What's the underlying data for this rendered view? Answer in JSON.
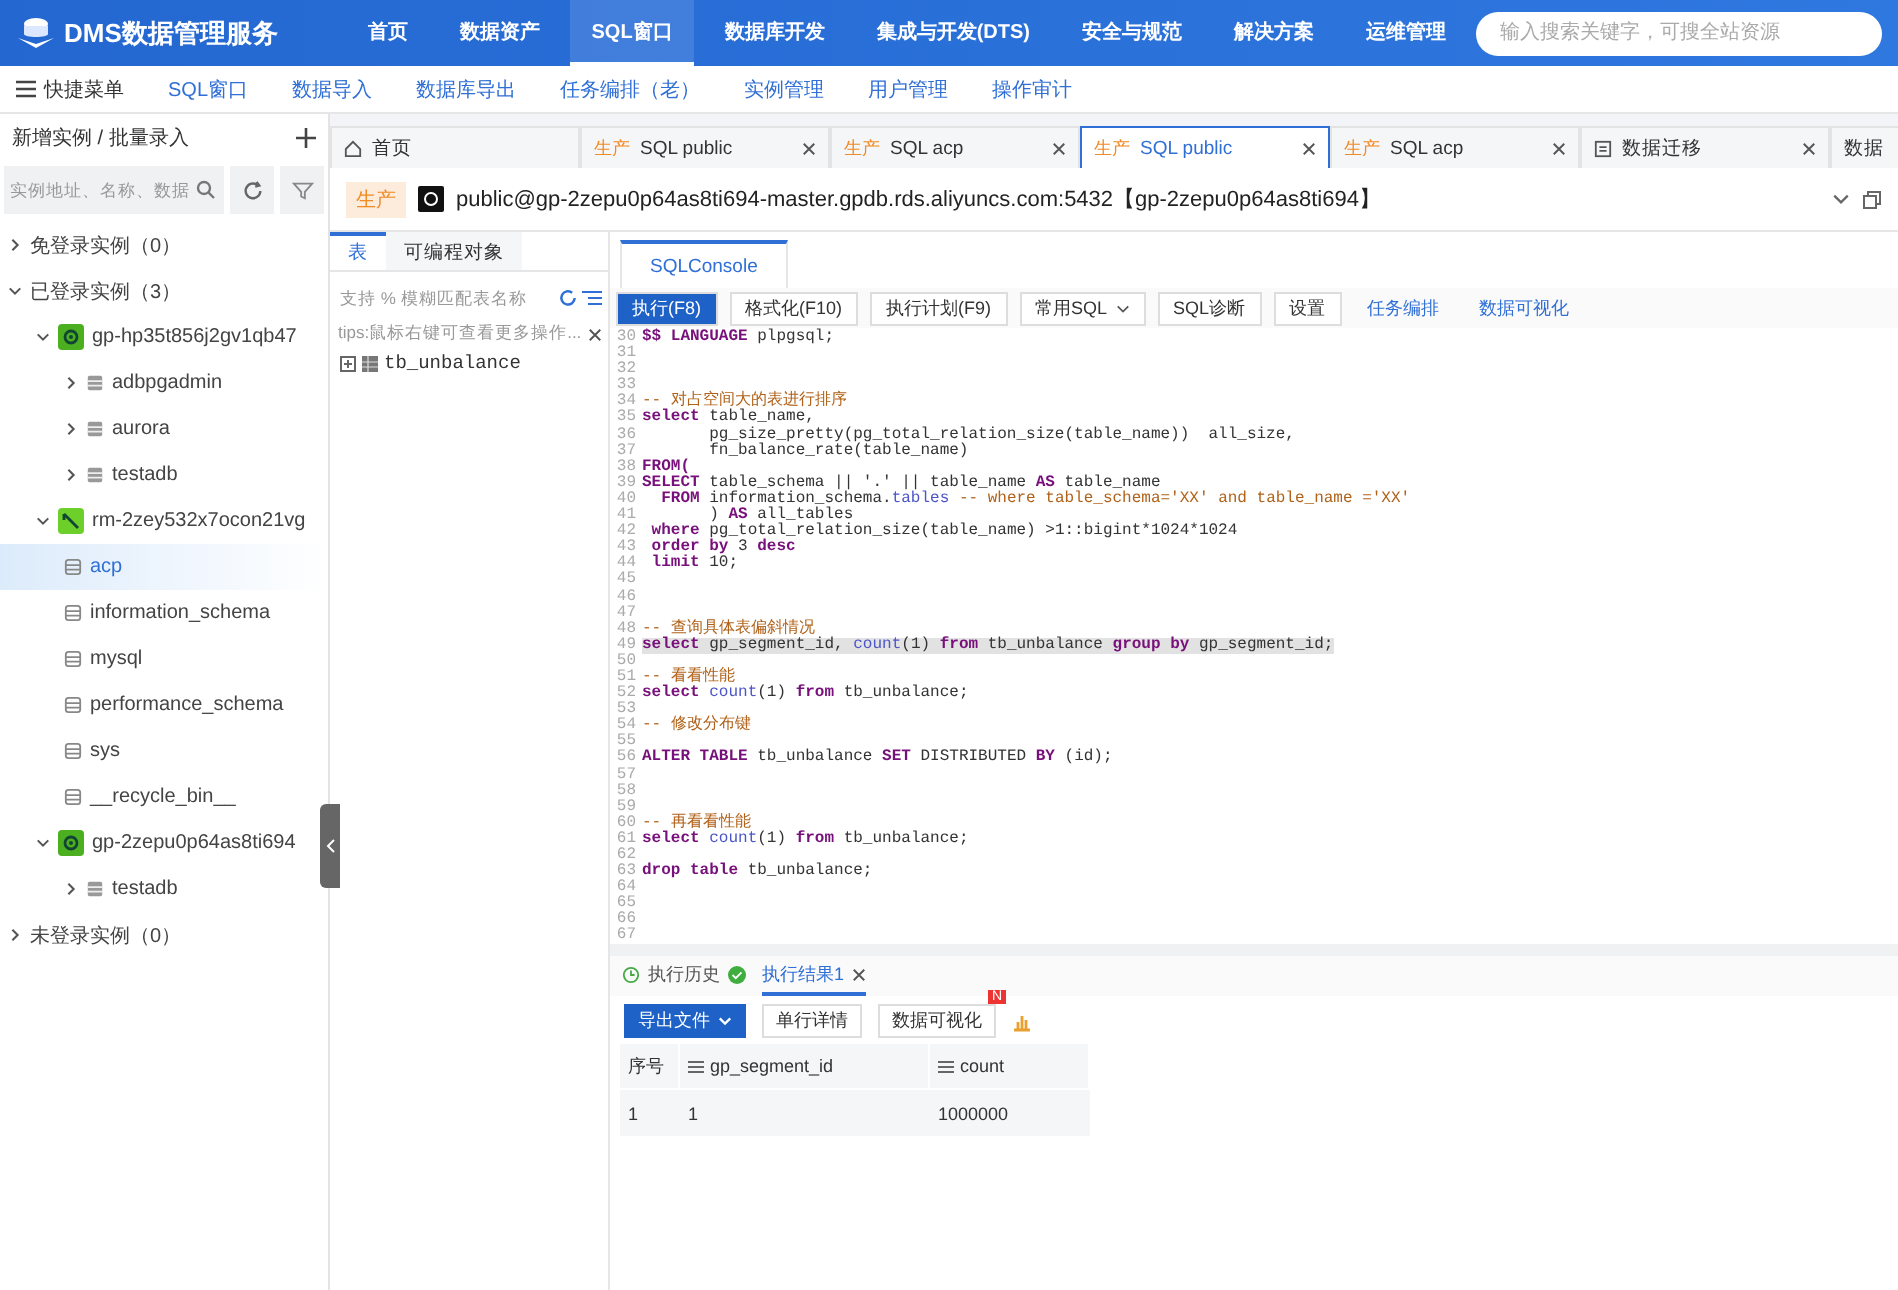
{
  "header": {
    "logo": "DMS数据管理服务",
    "nav": [
      {
        "label": "首页",
        "selected": false
      },
      {
        "label": "数据资产",
        "selected": false
      },
      {
        "label": "SQL窗口",
        "selected": true
      },
      {
        "label": "数据库开发",
        "selected": false
      },
      {
        "label": "集成与开发(DTS)",
        "selected": false
      },
      {
        "label": "安全与规范",
        "selected": false
      },
      {
        "label": "解决方案",
        "selected": false
      },
      {
        "label": "运维管理",
        "selected": false
      }
    ],
    "search": {
      "placeholder": "输入搜索关键字，可搜全站资源"
    }
  },
  "quick_menu": {
    "label": "快捷菜单",
    "items": [
      "SQL窗口",
      "数据导入",
      "数据库导出",
      "任务编排（老）",
      "实例管理",
      "用户管理",
      "操作审计"
    ]
  },
  "sidebar": {
    "add_label": "新增实例 / 批量录入",
    "search": {
      "placeholder": "实例地址、名称、数据"
    },
    "tree": [
      {
        "label": "免登录实例（0）",
        "kind": "group",
        "expanded": false,
        "selected": false
      },
      {
        "label": "已登录实例（3）",
        "kind": "group",
        "expanded": true,
        "selected": false,
        "children": [
          {
            "label": "gp-hp35t856j2gv1qb47",
            "kind": "gpinstance",
            "expanded": true,
            "selected": false,
            "children": [
              {
                "label": "adbpgadmin",
                "kind": "database",
                "expanded": false,
                "selected": false
              },
              {
                "label": "aurora",
                "kind": "database",
                "expanded": false,
                "selected": false
              },
              {
                "label": "testadb",
                "kind": "database",
                "expanded": false,
                "selected": false
              }
            ]
          },
          {
            "label": "rm-2zey532x7ocon21vg",
            "kind": "rdsinstance",
            "expanded": true,
            "selected": false,
            "children": [
              {
                "label": "acp",
                "kind": "schema",
                "selected": true
              },
              {
                "label": "information_schema",
                "kind": "schema",
                "selected": false
              },
              {
                "label": "mysql",
                "kind": "schema",
                "selected": false
              },
              {
                "label": "performance_schema",
                "kind": "schema",
                "selected": false
              },
              {
                "label": "sys",
                "kind": "schema",
                "selected": false
              },
              {
                "label": "__recycle_bin__",
                "kind": "schema",
                "selected": false
              }
            ]
          },
          {
            "label": "gp-2zepu0p64as8ti694",
            "kind": "gpinstance",
            "expanded": true,
            "selected": false,
            "children": [
              {
                "label": "testadb",
                "kind": "database",
                "expanded": false,
                "selected": false
              }
            ]
          }
        ]
      },
      {
        "label": "未登录实例（0）",
        "kind": "group",
        "expanded": false,
        "selected": false
      }
    ]
  },
  "tabs": [
    {
      "kind": "home",
      "title": "首页",
      "selected": false
    },
    {
      "kind": "sql",
      "env": "生产",
      "title": "SQL public",
      "selected": false
    },
    {
      "kind": "sql",
      "env": "生产",
      "title": "SQL acp",
      "selected": false
    },
    {
      "kind": "sql",
      "env": "生产",
      "title": "SQL public",
      "selected": true
    },
    {
      "kind": "sql",
      "env": "生产",
      "title": "SQL acp",
      "selected": false
    },
    {
      "kind": "task",
      "title": "数据迁移",
      "selected": false
    },
    {
      "kind": "partial",
      "title": "数据",
      "selected": false
    }
  ],
  "connection": {
    "env": "生产",
    "address": "public@gp-2zepu0p64as8ti694-master.gpdb.rds.aliyuncs.com:5432【gp-2zepu0p64as8ti694】"
  },
  "object_panel": {
    "tabs": [
      {
        "label": "表",
        "selected": true
      },
      {
        "label": "可编程对象",
        "selected": false
      }
    ],
    "search": {
      "placeholder": "支持 % 模糊匹配表名称"
    },
    "tip": "tips:鼠标右键可查看更多操作...",
    "tables": [
      "tb_unbalance"
    ]
  },
  "console": {
    "tab": "SQLConsole",
    "toolbar": [
      {
        "label": "执行(F8)",
        "kind": "primary"
      },
      {
        "label": "格式化(F10)",
        "kind": "plain"
      },
      {
        "label": "执行计划(F9)",
        "kind": "plain"
      },
      {
        "label": "常用SQL",
        "kind": "dropdown"
      },
      {
        "label": "SQL诊断",
        "kind": "plain"
      },
      {
        "label": "设置",
        "kind": "plain"
      },
      {
        "label": "任务编排",
        "kind": "link"
      },
      {
        "label": "数据可视化",
        "kind": "link"
      }
    ],
    "lines": [
      {
        "no": "30",
        "parts": [
          {
            "t": "$$ LANGUAGE",
            "kind": "keyword"
          },
          {
            "t": " plpgsql;",
            "kind": "plain"
          }
        ]
      },
      {
        "no": "31"
      },
      {
        "no": "32"
      },
      {
        "no": "33"
      },
      {
        "no": "34",
        "parts": [
          {
            "t": "-- 对占空间大的表进行排序",
            "kind": "comment"
          }
        ]
      },
      {
        "no": "35",
        "parts": [
          {
            "t": "select",
            "kind": "keyword"
          },
          {
            "t": " table_name,",
            "kind": "plain"
          }
        ]
      },
      {
        "no": "36",
        "parts": [
          {
            "t": "       pg_size_pretty(pg_total_relation_size(table_name))  all_size,",
            "kind": "plain"
          }
        ]
      },
      {
        "no": "37",
        "parts": [
          {
            "t": "       fn_balance_rate(table_name)",
            "kind": "plain"
          }
        ]
      },
      {
        "no": "38",
        "parts": [
          {
            "t": "FROM(",
            "kind": "keyword"
          }
        ]
      },
      {
        "no": "39",
        "parts": [
          {
            "t": "SELECT",
            "kind": "keyword"
          },
          {
            "t": " table_schema || '.' || table_name ",
            "kind": "plain"
          },
          {
            "t": "AS",
            "kind": "keyword"
          },
          {
            "t": " table_name",
            "kind": "plain"
          }
        ]
      },
      {
        "no": "40",
        "parts": [
          {
            "t": "  FROM",
            "kind": "keyword"
          },
          {
            "t": " information_schema.",
            "kind": "plain"
          },
          {
            "t": "tables",
            "kind": "function"
          },
          {
            "t": " -- where table_schema='XX' and table_name ='XX'",
            "kind": "comment"
          }
        ]
      },
      {
        "no": "41",
        "parts": [
          {
            "t": "       ) ",
            "kind": "plain"
          },
          {
            "t": "AS",
            "kind": "keyword"
          },
          {
            "t": " all_tables",
            "kind": "plain"
          }
        ]
      },
      {
        "no": "42",
        "parts": [
          {
            "t": " where",
            "kind": "keyword"
          },
          {
            "t": " pg_total_relation_size(table_name) >1::bigint*1024*1024",
            "kind": "plain"
          }
        ]
      },
      {
        "no": "43",
        "parts": [
          {
            "t": " order by",
            "kind": "keyword"
          },
          {
            "t": " 3 ",
            "kind": "plain"
          },
          {
            "t": "desc",
            "kind": "keyword"
          }
        ]
      },
      {
        "no": "44",
        "parts": [
          {
            "t": " limit",
            "kind": "keyword"
          },
          {
            "t": " 10;",
            "kind": "plain"
          }
        ]
      },
      {
        "no": "45"
      },
      {
        "no": "46"
      },
      {
        "no": "47"
      },
      {
        "no": "48",
        "parts": [
          {
            "t": "-- 查询具体表偏斜情况",
            "kind": "comment"
          }
        ]
      },
      {
        "no": "49",
        "highlighted": true,
        "parts": [
          {
            "t": "select",
            "kind": "keyword"
          },
          {
            "t": " gp_segment_id, ",
            "kind": "plain"
          },
          {
            "t": "count",
            "kind": "function"
          },
          {
            "t": "(1) ",
            "kind": "plain"
          },
          {
            "t": "from",
            "kind": "keyword"
          },
          {
            "t": " tb_unbalance ",
            "kind": "plain"
          },
          {
            "t": "group by",
            "kind": "keyword"
          },
          {
            "t": " gp_segment_id;",
            "kind": "plain"
          }
        ]
      },
      {
        "no": "50"
      },
      {
        "no": "51",
        "parts": [
          {
            "t": "-- 看看性能",
            "kind": "comment"
          }
        ]
      },
      {
        "no": "52",
        "parts": [
          {
            "t": "select",
            "kind": "keyword"
          },
          {
            "t": " count",
            "kind": "function"
          },
          {
            "t": "(1) ",
            "kind": "plain"
          },
          {
            "t": "from",
            "kind": "keyword"
          },
          {
            "t": " tb_unbalance;",
            "kind": "plain"
          }
        ]
      },
      {
        "no": "53"
      },
      {
        "no": "54",
        "parts": [
          {
            "t": "-- 修改分布键",
            "kind": "comment"
          }
        ]
      },
      {
        "no": "55"
      },
      {
        "no": "56",
        "parts": [
          {
            "t": "ALTER TABLE",
            "kind": "keyword"
          },
          {
            "t": " tb_unbalance ",
            "kind": "plain"
          },
          {
            "t": "SET",
            "kind": "keyword"
          },
          {
            "t": " DISTRIBUTED ",
            "kind": "plain"
          },
          {
            "t": "BY",
            "kind": "keyword"
          },
          {
            "t": " (id);",
            "kind": "plain"
          }
        ]
      },
      {
        "no": "57"
      },
      {
        "no": "58"
      },
      {
        "no": "59"
      },
      {
        "no": "60",
        "parts": [
          {
            "t": "-- 再看看性能",
            "kind": "comment"
          }
        ]
      },
      {
        "no": "61",
        "parts": [
          {
            "t": "select",
            "kind": "keyword"
          },
          {
            "t": " count",
            "kind": "function"
          },
          {
            "t": "(1) ",
            "kind": "plain"
          },
          {
            "t": "from",
            "kind": "keyword"
          },
          {
            "t": " tb_unbalance;",
            "kind": "plain"
          }
        ]
      },
      {
        "no": "62"
      },
      {
        "no": "63",
        "parts": [
          {
            "t": "drop table",
            "kind": "keyword"
          },
          {
            "t": " tb_unbalance;",
            "kind": "plain"
          }
        ]
      },
      {
        "no": "64"
      },
      {
        "no": "65"
      },
      {
        "no": "66"
      },
      {
        "no": "67"
      }
    ]
  },
  "results": {
    "tabs": [
      {
        "label": "执行历史",
        "kind": "history",
        "selected": false
      },
      {
        "label": "执行结果1",
        "kind": "result",
        "selected": true
      }
    ],
    "buttons": [
      {
        "label": "导出文件",
        "kind": "primary"
      },
      {
        "label": "单行详情",
        "kind": "plain"
      },
      {
        "label": "数据可视化",
        "kind": "badge",
        "badge": "N"
      }
    ],
    "columns": [
      "序号",
      "gp_segment_id",
      "count"
    ],
    "rows": [
      [
        "1",
        "1",
        "1000000"
      ]
    ]
  }
}
